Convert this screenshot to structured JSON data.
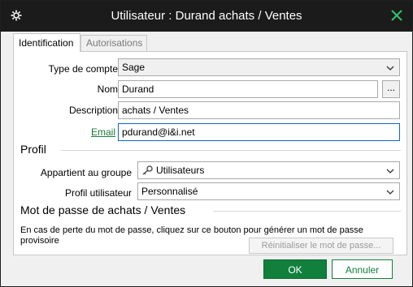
{
  "window": {
    "title": "Utilisateur : Durand achats / Ventes"
  },
  "tabs": [
    {
      "label": "Identification",
      "active": true
    },
    {
      "label": "Autorisations",
      "active": false
    }
  ],
  "identification": {
    "account_type_label": "Type de compte",
    "account_type_value": "Sage",
    "name_label": "Nom",
    "name_value": "Durand",
    "name_more_label": "...",
    "description_label": "Description",
    "description_value": "achats / Ventes",
    "email_label": "Email",
    "email_value": "pdurand@i&i.net"
  },
  "profile": {
    "section_title": "Profil",
    "group_label": "Appartient au groupe",
    "group_value": "Utilisateurs",
    "user_profile_label": "Profil utilisateur",
    "user_profile_value": "Personnalisé"
  },
  "password": {
    "section_title": "Mot de passe de achats / Ventes",
    "info_text": "En cas de perte du mot de passe, cliquez sur ce bouton pour générer un mot de passe provisoire",
    "reset_button_label": "Réinitialiser le mot de passe..."
  },
  "footer": {
    "ok_label": "OK",
    "cancel_label": "Annuler"
  },
  "colors": {
    "accent_green": "#11803d",
    "titlebar_bg": "#1b1b1b",
    "focus_blue": "#0b67d0"
  }
}
